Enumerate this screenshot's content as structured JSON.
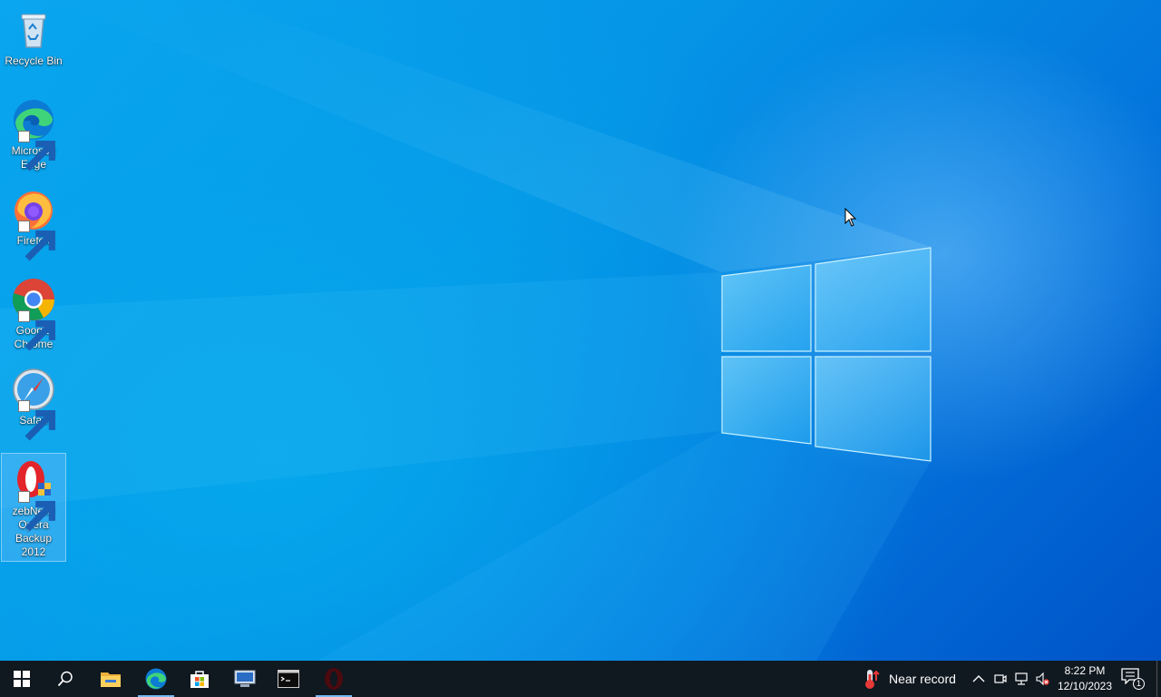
{
  "desktop": {
    "icons": [
      {
        "label": "Recycle Bin",
        "icon": "recycle-bin-icon"
      },
      {
        "label": "Microsoft Edge",
        "icon": "edge-icon"
      },
      {
        "label": "Firefox",
        "icon": "firefox-icon"
      },
      {
        "label": "Google Chrome",
        "icon": "chrome-icon"
      },
      {
        "label": "Safari",
        "icon": "safari-icon"
      },
      {
        "label": "zebNet® Opera Backup 2012",
        "icon": "opera-backup-icon",
        "selected": true
      }
    ],
    "wallpaper": "windows-10-hero",
    "accent": "#0078d7"
  },
  "taskbar": {
    "pinned": [
      {
        "name": "start-button",
        "icon": "windows-logo-icon"
      },
      {
        "name": "search-button",
        "icon": "search-icon"
      },
      {
        "name": "file-explorer",
        "icon": "folder-icon"
      },
      {
        "name": "edge",
        "icon": "edge-icon",
        "active": true
      },
      {
        "name": "microsoft-store",
        "icon": "store-icon"
      },
      {
        "name": "remote-desktop",
        "icon": "remote-desktop-icon"
      },
      {
        "name": "terminal",
        "icon": "terminal-icon"
      },
      {
        "name": "opera",
        "icon": "opera-icon",
        "active": true
      }
    ],
    "weather": {
      "text": "Near record",
      "icon": "thermometer-icon"
    },
    "tray": [
      "chevron-up-icon",
      "meet-now-icon",
      "network-icon",
      "volume-muted-icon"
    ],
    "clock": {
      "time": "8:22 PM",
      "date": "12/10/2023"
    },
    "notifications": {
      "count": "1"
    }
  }
}
